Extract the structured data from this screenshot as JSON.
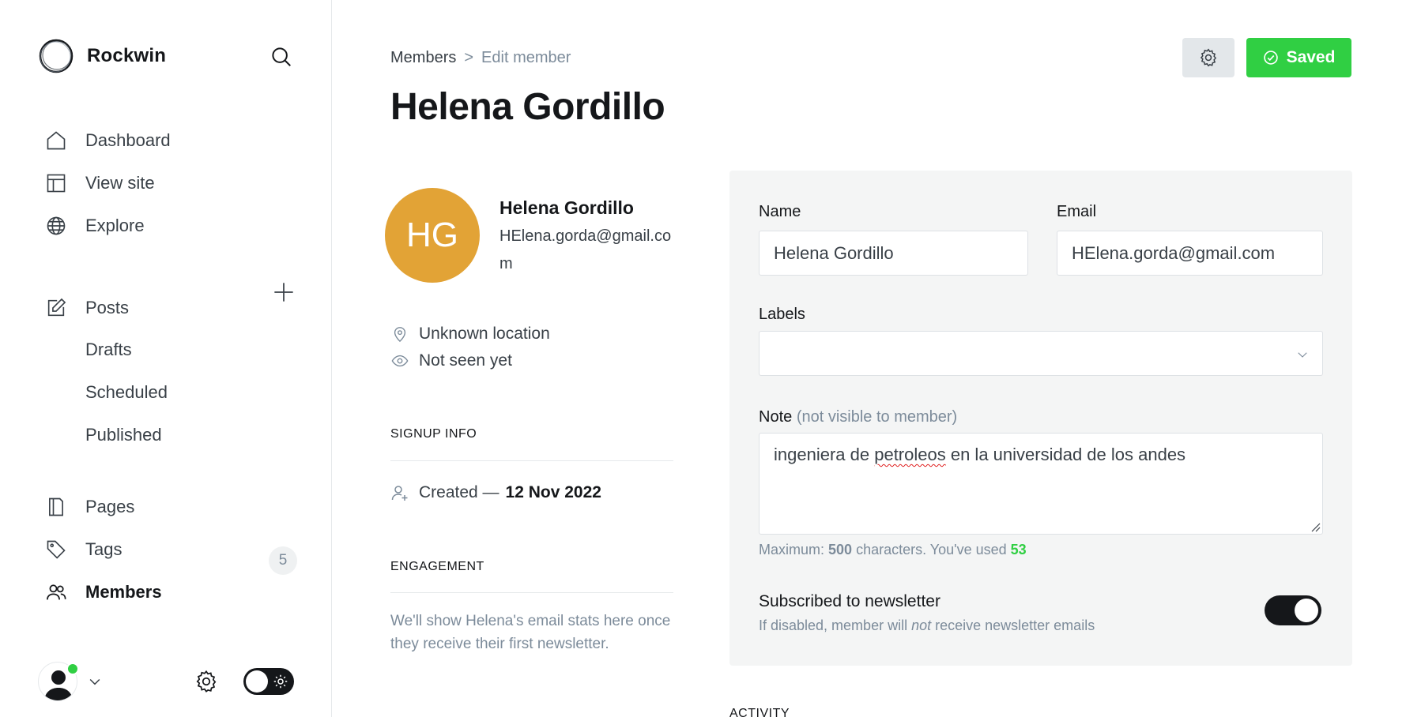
{
  "sidebar": {
    "brand": "Rockwin",
    "nav": [
      {
        "label": "Dashboard",
        "icon": "home-icon"
      },
      {
        "label": "View site",
        "icon": "layout-icon"
      },
      {
        "label": "Explore",
        "icon": "globe-icon"
      },
      {
        "label": "Posts",
        "icon": "edit-icon"
      },
      {
        "label": "Pages",
        "icon": "page-icon"
      },
      {
        "label": "Tags",
        "icon": "tag-icon"
      },
      {
        "label": "Members",
        "icon": "members-icon",
        "count": "5"
      }
    ],
    "post_subitems": [
      "Drafts",
      "Scheduled",
      "Published"
    ]
  },
  "header": {
    "breadcrumb_parent": "Members",
    "breadcrumb_sep": ">",
    "breadcrumb_current": "Edit member",
    "title": "Helena Gordillo",
    "save_label": "Saved"
  },
  "member": {
    "initials": "HG",
    "name": "Helena Gordillo",
    "email": "HElena.gorda@gmail.com",
    "location": "Unknown location",
    "last_seen": "Not seen yet",
    "signup_heading": "SIGNUP INFO",
    "created_label": "Created —",
    "created_date": "12 Nov 2022",
    "engagement_heading": "ENGAGEMENT",
    "engagement_text": "We'll show Helena's email stats here once they receive their first newsletter.",
    "avatar_color": "#e2a336"
  },
  "form": {
    "name_label": "Name",
    "name_value": "Helena Gordillo",
    "email_label": "Email",
    "email_value": "HElena.gorda@gmail.com",
    "labels_label": "Labels",
    "note_label": "Note",
    "note_hint": "(not visible to member)",
    "note_before": "ingeniera de ",
    "note_misspelled": "petroleos",
    "note_after": " en la universidad de los andes",
    "count_prefix": "Maximum: ",
    "count_max": "500",
    "count_mid": " characters. You've used ",
    "count_used": "53",
    "newsletter_title": "Subscribed to newsletter",
    "newsletter_sub_prefix": "If disabled, member will ",
    "newsletter_sub_em": "not",
    "newsletter_sub_suffix": " receive newsletter emails",
    "newsletter_enabled": true
  },
  "activity_heading": "ACTIVITY",
  "colors": {
    "accent_green": "#30cf43",
    "text_dark": "#15171a",
    "muted": "#7c8b9a"
  }
}
